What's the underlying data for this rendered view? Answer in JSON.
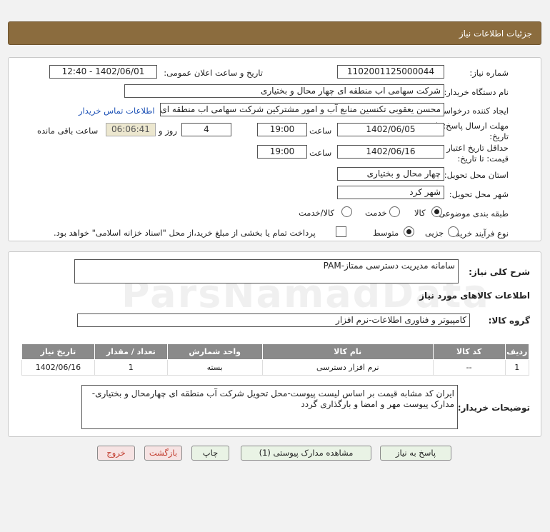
{
  "header": {
    "title": "جزئیات اطلاعات نیاز"
  },
  "form": {
    "need_number_label": "شماره نیاز:",
    "need_number": "1102001125000044",
    "announce_label": "تاریخ و ساعت اعلان عمومی:",
    "announce_value": "1402/06/01 - 12:40",
    "buyer_label": "نام دستگاه خریدار:",
    "buyer_value": "شرکت سهامی اب منطقه ای چهار محال و بختیاری",
    "requester_label": "ایجاد کننده درخواست:",
    "requester_value": "محسن یعقوبی تکنسین منابع آب و امور مشترکین شرکت سهامی اب منطقه ای",
    "contact_link": "اطلاعات تماس خریدار",
    "deadline_label_1": "مهلت ارسال پاسخ: تا",
    "deadline_label_2": "تاریخ:",
    "deadline_date": "1402/06/05",
    "time_label": "ساعت",
    "deadline_time": "19:00",
    "days_value": "4",
    "days_label": "روز و",
    "remaining_time": "06:06:41",
    "remaining_label": "ساعت باقی مانده",
    "validity_label_1": "حداقل تاریخ اعتبار",
    "validity_label_2": "قیمت: تا تاریخ:",
    "validity_date": "1402/06/16",
    "validity_time": "19:00",
    "province_label": "استان محل تحویل:",
    "province_value": "چهار محال و بختیاری",
    "city_label": "شهر محل تحویل:",
    "city_value": "شهر کرد",
    "category_label": "طبقه بندی موضوعی:",
    "category_options": [
      "کالا",
      "خدمت",
      "کالا/خدمت"
    ],
    "process_label": "نوع فرآیند خرید :",
    "process_options": [
      "جزیی",
      "متوسط"
    ],
    "payment_note": "پرداخت تمام یا بخشی از مبلغ خرید،از محل \"اسناد خزانه اسلامی\" خواهد بود."
  },
  "need": {
    "summary_label": "شرح کلی نیاز:",
    "summary_value": "سامانه مدیریت دسترسی ممتاز-PAM",
    "goods_info_title": "اطلاعات کالاهای مورد نیاز",
    "goods_group_label": "گروه کالا:",
    "goods_group_value": "کامپیوتر و فناوری اطلاعات-نرم افزار",
    "table_headers": [
      "ردیف",
      "کد کالا",
      "نام کالا",
      "واحد شمارش",
      "تعداد / مقدار",
      "تاریخ نیاز"
    ],
    "rows": [
      {
        "idx": "1",
        "code": "--",
        "name": "نرم افزار دسترسی",
        "unit": "بسته",
        "qty": "1",
        "date": "1402/06/16"
      }
    ],
    "buyer_notes_label": "توضیحات خریدار:",
    "buyer_notes_line1": "ایران کد مشابه قیمت بر اساس لیست پیوست-محل تحویل شرکت آب منطقه ای چهارمحال و بختیاری-",
    "buyer_notes_line2": "مدارک پیوست مهر و امضا و بارگذاری گردد"
  },
  "buttons": {
    "reply": "پاسخ به نیاز",
    "attachments": "مشاهده مدارک پیوستی (1)",
    "print": "چاپ",
    "back": "بازگشت",
    "exit": "خروج"
  },
  "watermark": "ParsNamadData",
  "colors": {
    "header": "#8b6c3e",
    "table_header": "#8a8a8a",
    "link": "#1a4fb5"
  }
}
